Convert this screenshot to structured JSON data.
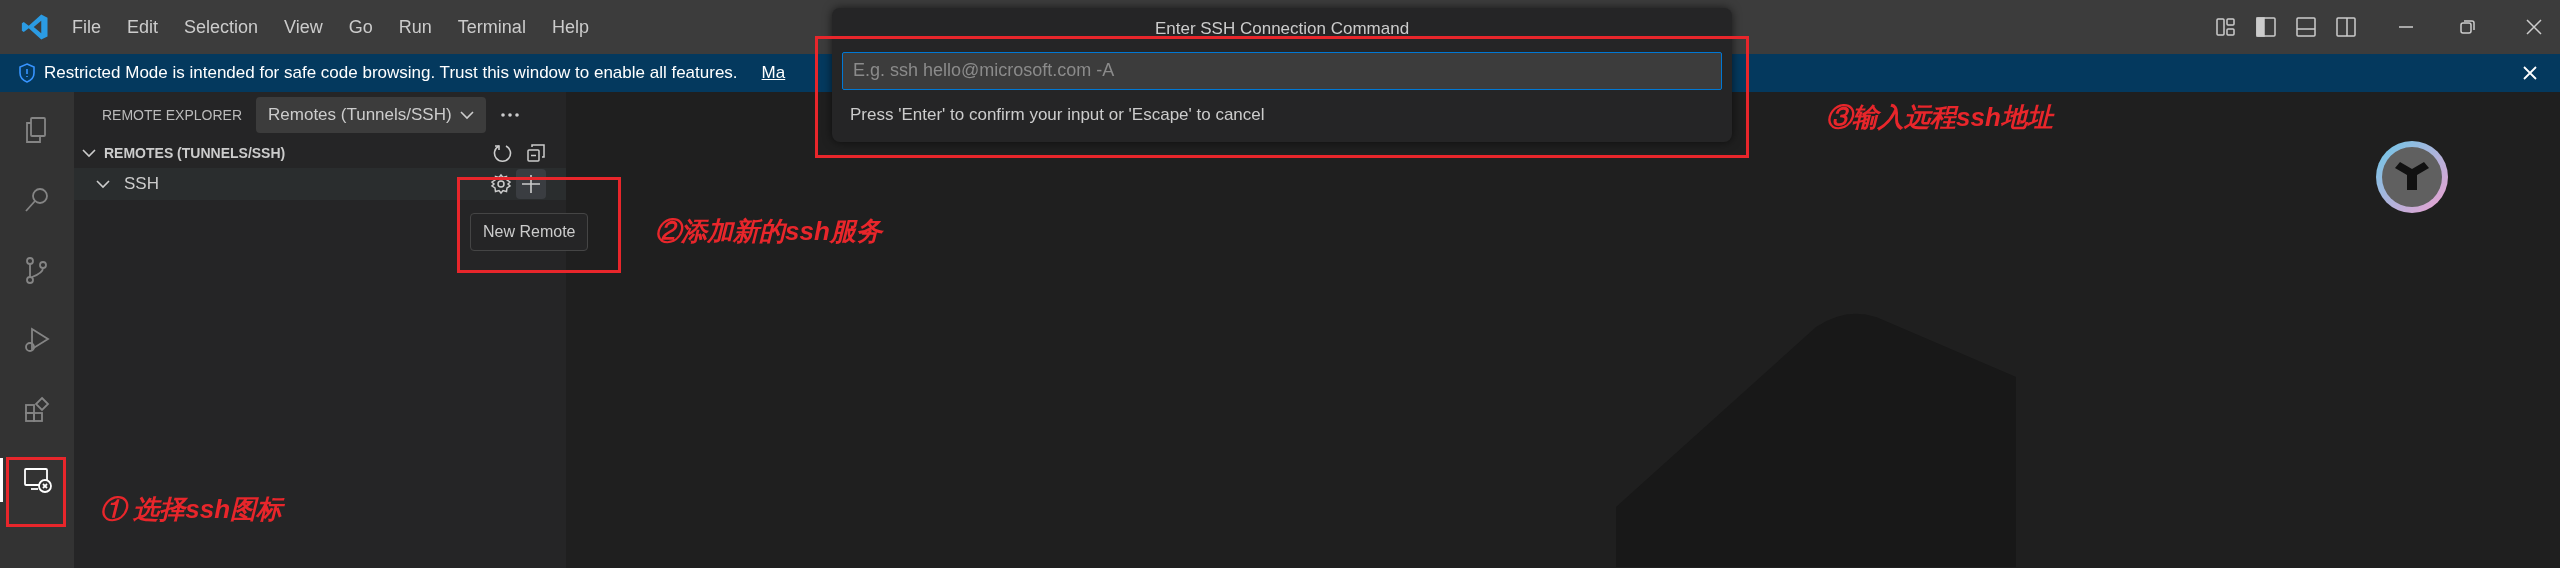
{
  "title_bar": {
    "menu": [
      "File",
      "Edit",
      "Selection",
      "View",
      "Go",
      "Run",
      "Terminal",
      "Help"
    ]
  },
  "banner": {
    "message": "Restricted Mode is intended for safe code browsing. Trust this window to enable all features.",
    "link": "Ma"
  },
  "activity_bar": {
    "items": [
      {
        "kind": "files",
        "selected": false
      },
      {
        "kind": "search",
        "selected": false
      },
      {
        "kind": "branch",
        "selected": false
      },
      {
        "kind": "debug",
        "selected": false
      },
      {
        "kind": "extensions",
        "selected": false
      },
      {
        "kind": "remote",
        "selected": true
      }
    ]
  },
  "sidebar": {
    "title": "REMOTE EXPLORER",
    "dropdown": "Remotes (Tunnels/SSH)",
    "section": {
      "title": "REMOTES (TUNNELS/SSH)",
      "expanded": true
    },
    "tree": [
      {
        "label": "SSH",
        "expanded": true
      }
    ],
    "tooltip": "New Remote"
  },
  "dialog": {
    "title": "Enter SSH Connection Command",
    "placeholder": "E.g. ssh hello@microsoft.com -A",
    "hint": "Press 'Enter' to confirm your input or 'Escape' to cancel"
  },
  "annotations": [
    "③输入远程ssh地址",
    "②添加新的ssh服务",
    "① 选择ssh图标"
  ]
}
